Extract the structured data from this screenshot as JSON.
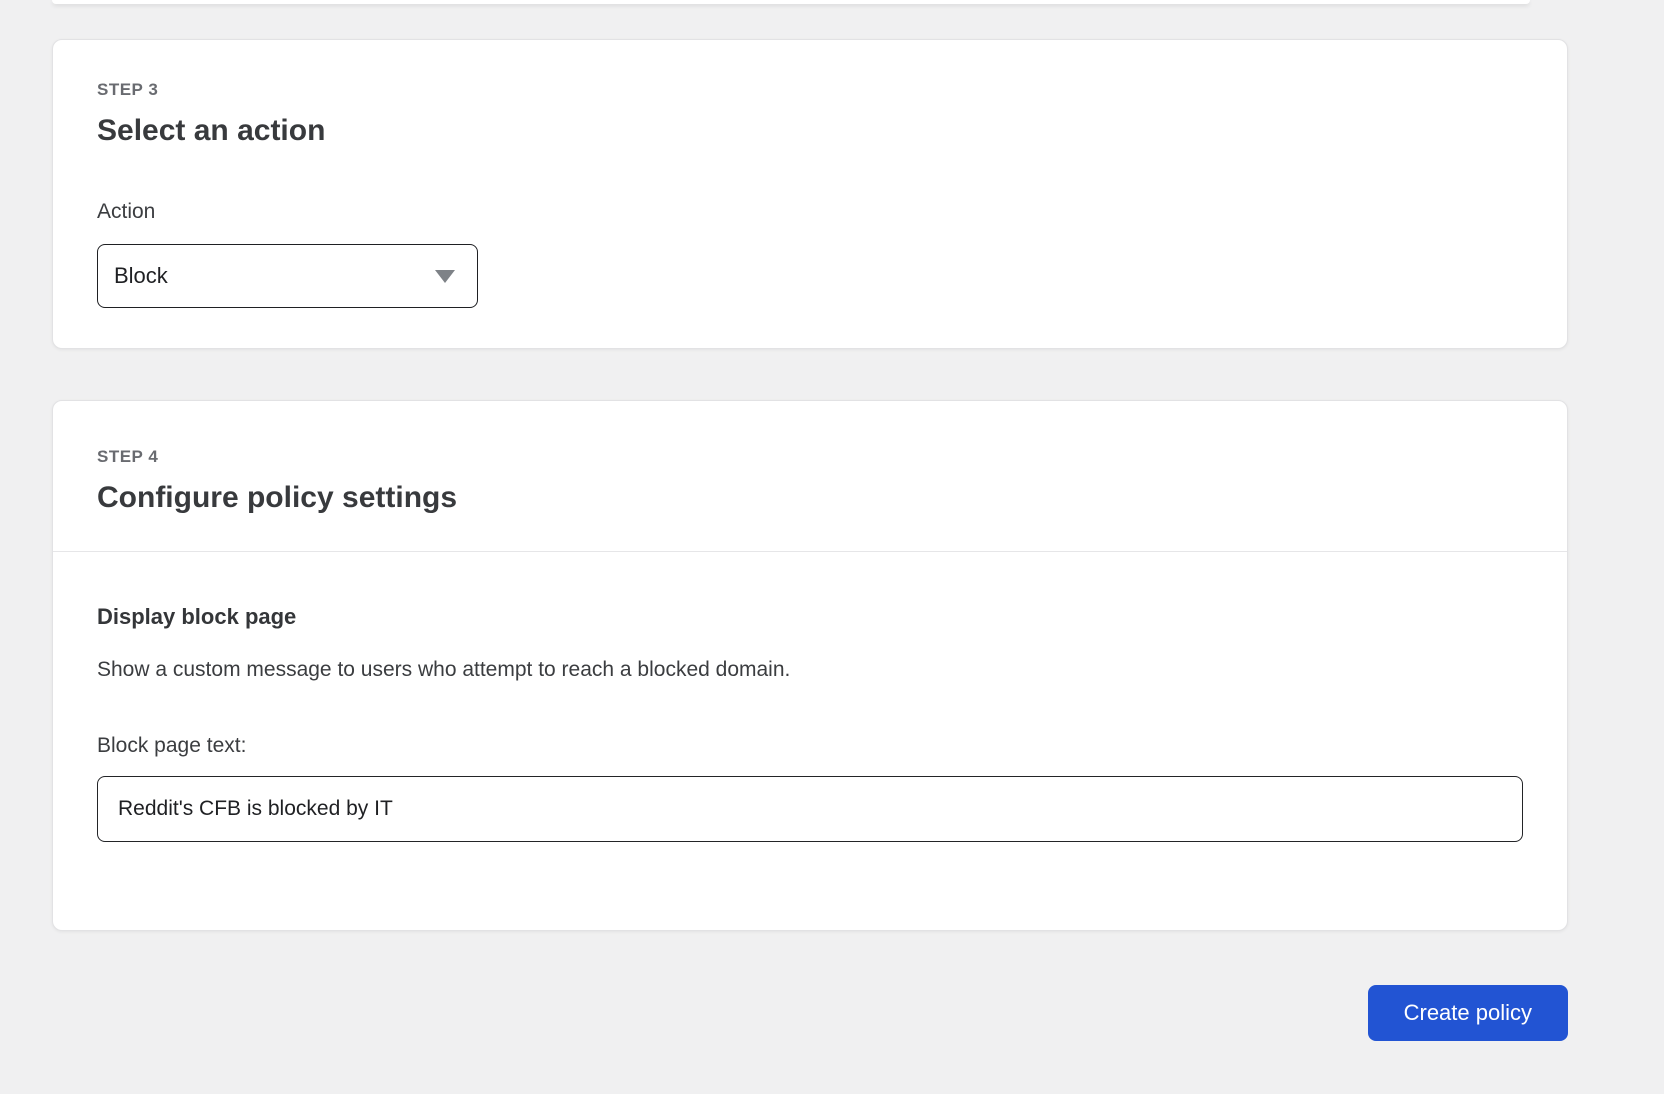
{
  "page": {
    "background_color": "#f0f0f1",
    "card_color": "#ffffff",
    "accent_color": "#2254d3",
    "border_color": "#1f2023"
  },
  "step3": {
    "step_label": "STEP 3",
    "title": "Select an action",
    "action": {
      "label": "Action",
      "selected_value": "Block",
      "icon": "chevron-down-icon"
    }
  },
  "step4": {
    "step_label": "STEP 4",
    "title": "Configure policy settings",
    "block_page": {
      "section_title": "Display block page",
      "description": "Show a custom message to users who attempt to reach a blocked domain.",
      "input_label": "Block page text:",
      "input_value": "Reddit's CFB is blocked by IT"
    }
  },
  "footer": {
    "create_button_label": "Create policy"
  }
}
